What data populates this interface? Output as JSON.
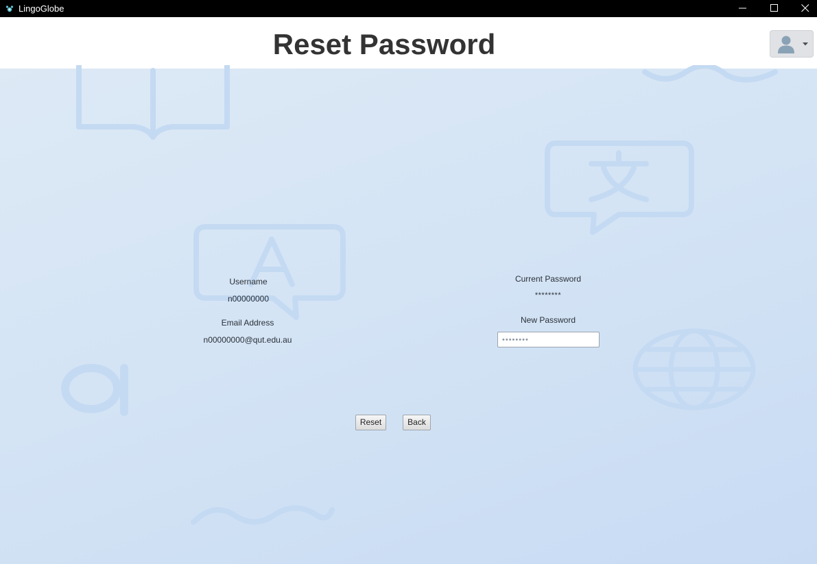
{
  "window": {
    "title": "LingoGlobe",
    "icons": {
      "app": "lingoglobe-logo-icon",
      "minimize": "minimize-icon",
      "maximize": "maximize-icon",
      "close": "close-icon"
    }
  },
  "header": {
    "title": "Reset Password",
    "user_menu": {
      "icon": "user-avatar-icon",
      "caret": "chevron-down-icon"
    }
  },
  "account": {
    "username_label": "Username",
    "username_value": "n00000000",
    "email_label": "Email Address",
    "email_value": "n00000000@qut.edu.au"
  },
  "password": {
    "current_label": "Current Password",
    "current_value": "********",
    "new_label": "New Password",
    "new_placeholder": "••••••••",
    "new_value": ""
  },
  "actions": {
    "reset_label": "Reset",
    "back_label": "Back"
  },
  "colors": {
    "titlebar": "#000000",
    "header_bg": "#ffffff",
    "title_text": "#333333",
    "background": "#d4e4f5",
    "decoration": "#c4daf2"
  }
}
